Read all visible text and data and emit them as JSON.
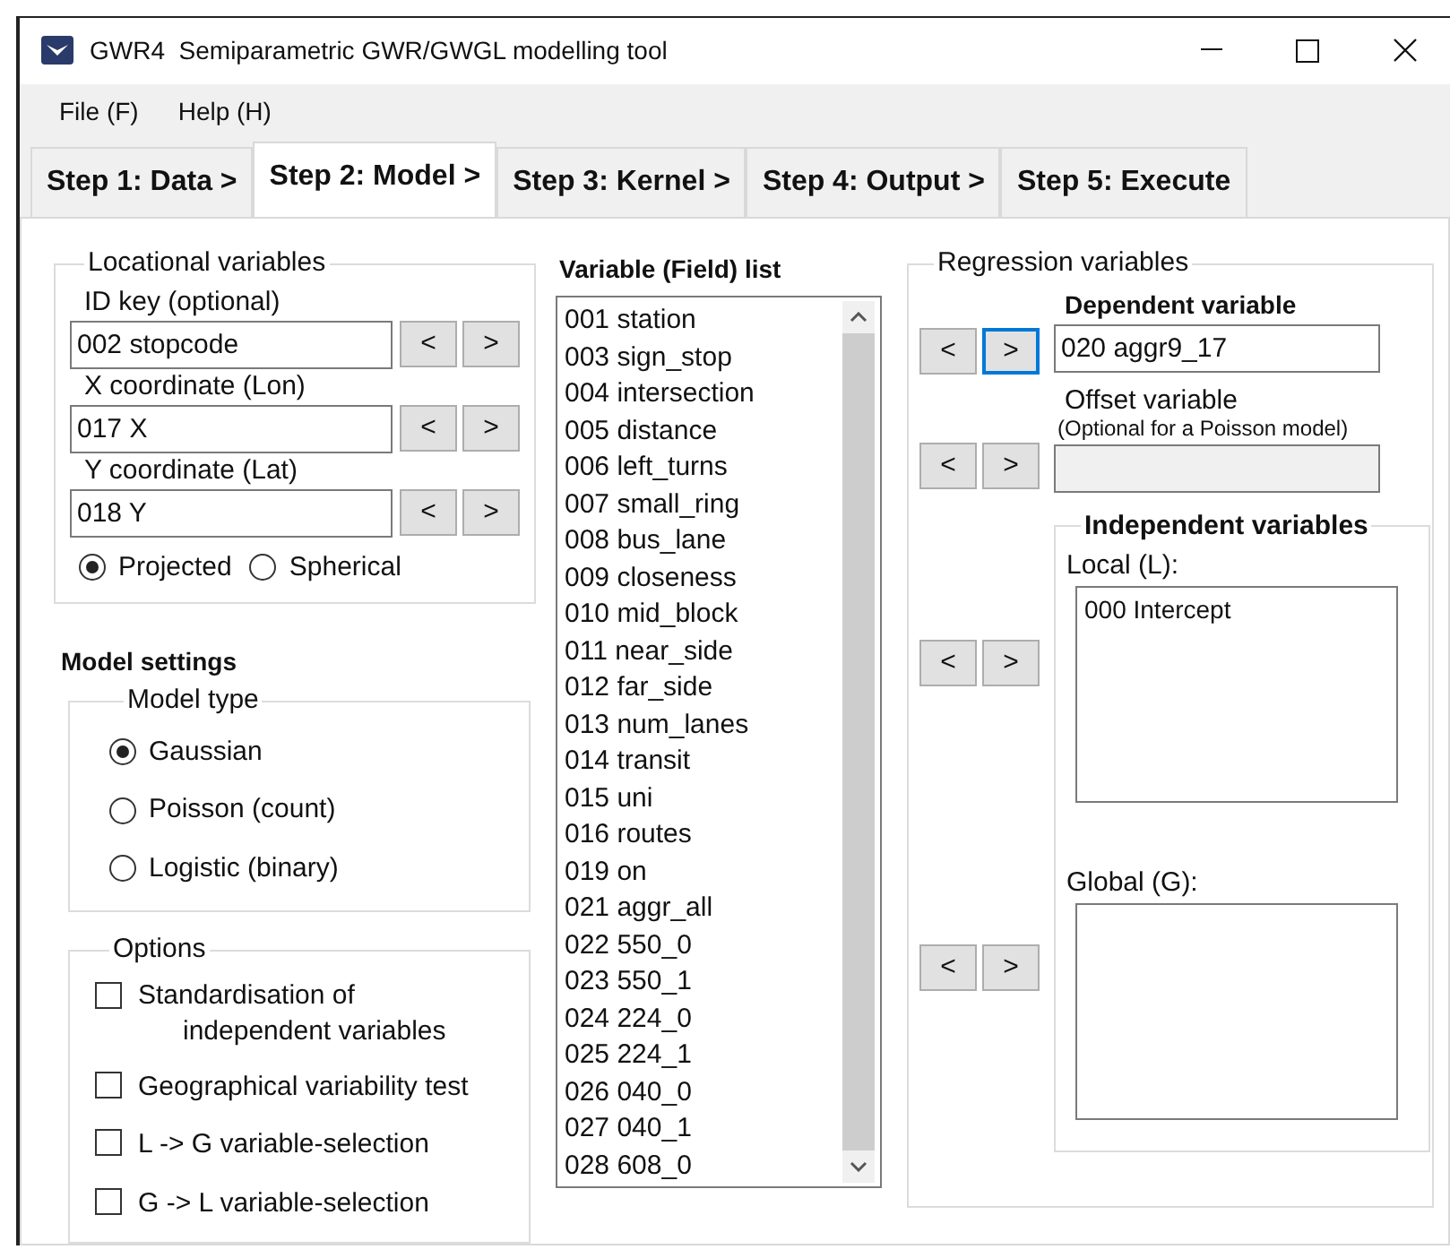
{
  "window": {
    "title": "GWR4  Semiparametric GWR/GWGL modelling tool"
  },
  "menu": [
    {
      "label": "File (F)"
    },
    {
      "label": "Help (H)"
    }
  ],
  "tabs": [
    {
      "label": "Step 1: Data >",
      "selected": false
    },
    {
      "label": "Step 2: Model >",
      "selected": true
    },
    {
      "label": "Step 3: Kernel >",
      "selected": false
    },
    {
      "label": "Step 4: Output >",
      "selected": false
    },
    {
      "label": "Step 5: Execute",
      "selected": false
    }
  ],
  "locational": {
    "legend": "Locational variables",
    "fields": [
      {
        "label": "ID key (optional)",
        "value": "002 stopcode",
        "buttons": [
          {
            "label": "<",
            "focused": false
          },
          {
            "label": ">",
            "focused": false
          }
        ]
      },
      {
        "label": "X coordinate (Lon)",
        "value": "017 X",
        "buttons": [
          {
            "label": "<",
            "focused": false
          },
          {
            "label": ">",
            "focused": false
          }
        ]
      },
      {
        "label": "Y coordinate (Lat)",
        "value": "018 Y",
        "buttons": [
          {
            "label": "<",
            "focused": false
          },
          {
            "label": ">",
            "focused": false
          }
        ]
      }
    ],
    "coordinates": [
      {
        "label": "Projected",
        "selected": true
      },
      {
        "label": "Spherical",
        "selected": false
      }
    ]
  },
  "model_settings": {
    "title": "Model settings",
    "model_type": {
      "legend": "Model type",
      "options": [
        {
          "label": "Gaussian",
          "selected": true
        },
        {
          "label": "Poisson (count)",
          "selected": false
        },
        {
          "label": "Logistic (binary)",
          "selected": false
        }
      ]
    }
  },
  "options": {
    "legend": "Options",
    "items": [
      {
        "label": "Standardisation of independent variables",
        "checked": false
      },
      {
        "label": "Geographical variability test",
        "checked": false
      },
      {
        "label": "L -> G variable-selection",
        "checked": false
      },
      {
        "label": "G -> L variable-selection",
        "checked": false
      }
    ]
  },
  "variable_list": {
    "title": "Variable (Field) list",
    "items": [
      "001 station",
      "003 sign_stop",
      "004 intersection",
      "005 distance",
      "006 left_turns",
      "007 small_ring",
      "008 bus_lane",
      "009 closeness",
      "010 mid_block",
      "011 near_side",
      "012 far_side",
      "013 num_lanes",
      "014 transit",
      "015 uni",
      "016 routes",
      "019 on",
      "021 aggr_all",
      "022 550_0",
      "023 550_1",
      "024 224_0",
      "025 224_1",
      "026 040_0",
      "027 040_1",
      "028 608_0"
    ]
  },
  "regression": {
    "legend": "Regression variables",
    "dependent": {
      "label": "Dependent variable",
      "value": "020 aggr9_17",
      "buttons": [
        {
          "label": "<",
          "focused": false
        },
        {
          "label": ">",
          "focused": true
        }
      ]
    },
    "offset": {
      "label": "Offset variable",
      "note": "(Optional for a Poisson model)",
      "disabled": true,
      "buttons": [
        {
          "label": "<",
          "focused": false
        },
        {
          "label": ">",
          "focused": false
        }
      ]
    },
    "independent": {
      "legend": "Independent variables",
      "local": {
        "label": "Local (L):",
        "items": [
          "000 Intercept"
        ],
        "buttons": [
          {
            "label": "<",
            "focused": false
          },
          {
            "label": ">",
            "focused": false
          }
        ]
      },
      "global": {
        "label": "Global (G):",
        "buttons": [
          {
            "label": "<",
            "focused": false
          },
          {
            "label": ">",
            "focused": false
          }
        ]
      }
    }
  }
}
